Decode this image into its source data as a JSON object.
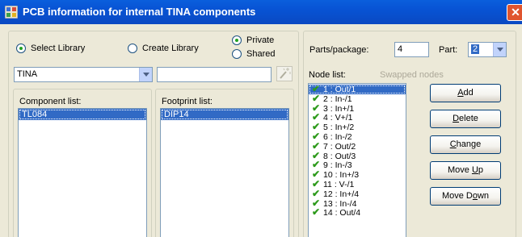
{
  "window": {
    "title": "PCB information for internal TINA components",
    "close_glyph": "✕"
  },
  "library": {
    "select_label": "Select Library",
    "create_label": "Create Library",
    "private_label": "Private",
    "shared_label": "Shared",
    "selected_mode": "select",
    "selected_scope": "private",
    "library_value": "TINA",
    "search_value": ""
  },
  "component_list": {
    "label": "Component list:",
    "items": [
      "TL084"
    ],
    "selected_index": 0
  },
  "footprint_list": {
    "label": "Footprint list:",
    "items": [
      "DIP14"
    ],
    "selected_index": 0
  },
  "parts": {
    "parts_label": "Parts/package:",
    "parts_value": "4",
    "part_label": "Part:",
    "part_value": "2"
  },
  "nodes": {
    "label": "Node list:",
    "swapped_label": "Swapped nodes",
    "items": [
      "1 : Out/1",
      "2 : In-/1",
      "3 : In+/1",
      "4 : V+/1",
      "5 : In+/2",
      "6 : In-/2",
      "7 : Out/2",
      "8 : Out/3",
      "9 : In-/3",
      "10 : In+/3",
      "11 : V-/1",
      "12 : In+/4",
      "13 : In-/4",
      "14 : Out/4"
    ],
    "selected_index": 0
  },
  "buttons": {
    "add": {
      "pre": "",
      "key": "A",
      "post": "dd"
    },
    "delete": {
      "pre": "",
      "key": "D",
      "post": "elete"
    },
    "change": {
      "pre": "",
      "key": "C",
      "post": "hange"
    },
    "move_up": {
      "pre": "Move ",
      "key": "U",
      "post": "p"
    },
    "move_down": {
      "pre": "Move D",
      "key": "o",
      "post": "wn"
    }
  },
  "colors": {
    "title_bar": "#0a5fdc",
    "selection": "#316ac5",
    "check": "#2d9a1b",
    "face": "#ece9d8"
  }
}
